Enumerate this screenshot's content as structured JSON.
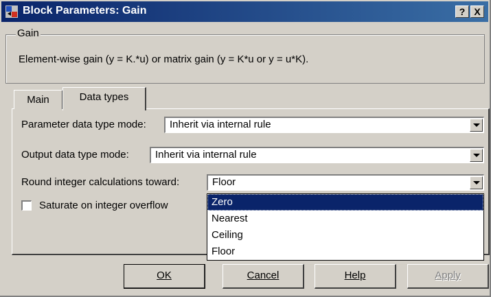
{
  "window": {
    "title": "Block Parameters: Gain",
    "help_button": "?",
    "close_button": "X"
  },
  "group": {
    "legend": "Gain",
    "description": "Element-wise gain (y = K.*u) or matrix gain (y = K*u or y = u*K)."
  },
  "tabs": [
    {
      "label": "Main",
      "active": false
    },
    {
      "label": "Data types",
      "active": true
    }
  ],
  "fields": {
    "param_mode_label": "Parameter data type mode:",
    "param_mode_value": "Inherit via internal rule",
    "output_mode_label": "Output data type mode:",
    "output_mode_value": "Inherit via internal rule",
    "round_label": "Round integer calculations toward:",
    "round_value": "Floor",
    "saturate_label": "Saturate on integer overflow",
    "saturate_checked": false
  },
  "round_options": [
    "Zero",
    "Nearest",
    "Ceiling",
    "Floor"
  ],
  "round_highlighted": "Zero",
  "buttons": {
    "ok": "OK",
    "cancel": "Cancel",
    "help": "Help",
    "apply": "Apply"
  },
  "colors": {
    "title_bar": "#0a246a",
    "face": "#d4d0c8",
    "selection": "#0a246a"
  }
}
